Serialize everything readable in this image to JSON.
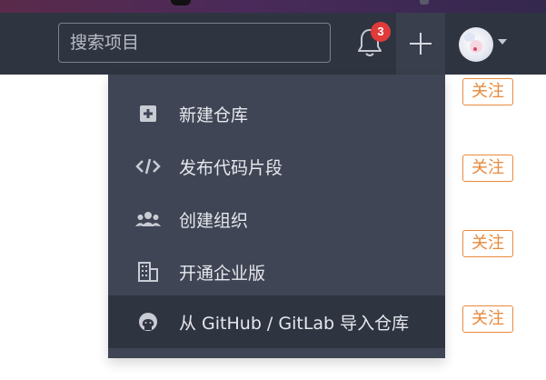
{
  "navbar": {
    "search": {
      "placeholder": "搜索项目",
      "value": ""
    },
    "notifications": {
      "count": "3"
    },
    "plus_label": "",
    "avatar": {
      "label": ""
    }
  },
  "menu": {
    "items": [
      {
        "label": "新建仓库",
        "icon": "plus-square-icon"
      },
      {
        "label": "发布代码片段",
        "icon": "code-icon"
      },
      {
        "label": "创建组织",
        "icon": "users-icon"
      },
      {
        "label": "开通企业版",
        "icon": "building-icon"
      },
      {
        "label": "从 GitHub / GitLab 导入仓库",
        "icon": "github-icon",
        "highlighted": true
      }
    ]
  },
  "follow_buttons": [
    {
      "label": "关注"
    },
    {
      "label": "关注"
    },
    {
      "label": "关注"
    },
    {
      "label": "关注"
    }
  ],
  "colors": {
    "navbar": "#2f3441",
    "menu": "#3f4555",
    "menu_active": "#2f3441",
    "badge": "#e03a3a",
    "follow": "#e8893c"
  }
}
